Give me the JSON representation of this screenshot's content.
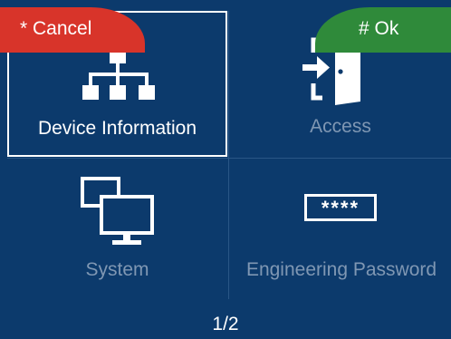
{
  "menu": {
    "tiles": [
      {
        "label": "Device Information",
        "icon": "network-hierarchy-icon",
        "selected": true
      },
      {
        "label": "Access",
        "icon": "door-enter-icon",
        "selected": false
      },
      {
        "label": "System",
        "icon": "monitors-icon",
        "selected": false
      },
      {
        "label": "Engineering Password",
        "icon": "password-box-icon",
        "selected": false
      }
    ],
    "password_mask": "****"
  },
  "footer": {
    "cancel_label": "* Cancel",
    "page_indicator": "1/2",
    "ok_label": "# Ok"
  },
  "colors": {
    "background": "#0c3a6c",
    "cancel": "#d8342a",
    "ok": "#2f8a3a",
    "dim_label": "#7f97b3"
  }
}
